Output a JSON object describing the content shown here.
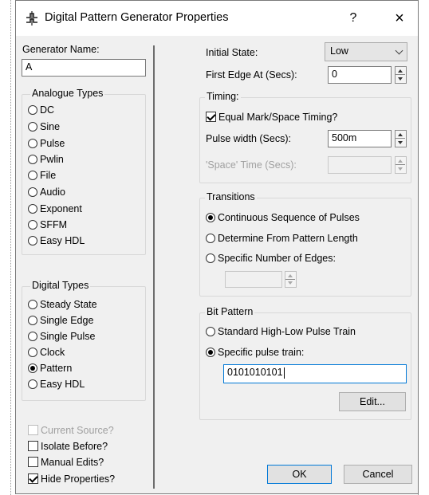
{
  "window": {
    "title": "Digital Pattern Generator Properties",
    "help_label": "?",
    "close_label": "×",
    "icon": "pulse-generator-icon"
  },
  "left": {
    "generator_name_label": "Generator Name:",
    "generator_name_value": "A",
    "analogue_types": {
      "title": "Analogue Types",
      "items": [
        "DC",
        "Sine",
        "Pulse",
        "Pwlin",
        "File",
        "Audio",
        "Exponent",
        "SFFM",
        "Easy HDL"
      ]
    },
    "digital_types": {
      "title": "Digital Types",
      "items": [
        "Steady State",
        "Single Edge",
        "Single Pulse",
        "Clock",
        "Pattern",
        "Easy HDL"
      ],
      "selected": "Pattern"
    },
    "checkboxes": {
      "current_source": "Current Source?",
      "isolate_before": "Isolate Before?",
      "manual_edits": "Manual Edits?",
      "hide_properties": "Hide Properties?"
    }
  },
  "right": {
    "initial_state_label": "Initial State:",
    "initial_state_value": "Low",
    "first_edge_label": "First Edge At (Secs):",
    "first_edge_value": "0",
    "timing": {
      "title": "Timing:",
      "equal_mark_space": "Equal Mark/Space Timing?",
      "pulse_width_label": "Pulse width (Secs):",
      "pulse_width_value": "500m",
      "space_time_label": "'Space' Time (Secs):",
      "space_time_value": ""
    },
    "transitions": {
      "title": "Transitions",
      "continuous": "Continuous Sequence of Pulses",
      "from_pattern": "Determine From Pattern Length",
      "specific_edges": "Specific Number of Edges:",
      "edges_value": ""
    },
    "bit_pattern": {
      "title": "Bit Pattern",
      "standard": "Standard High-Low Pulse Train",
      "specific": "Specific pulse train:",
      "pattern_value": "0101010101",
      "edit_label": "Edit..."
    }
  },
  "footer": {
    "ok_label": "OK",
    "cancel_label": "Cancel"
  }
}
